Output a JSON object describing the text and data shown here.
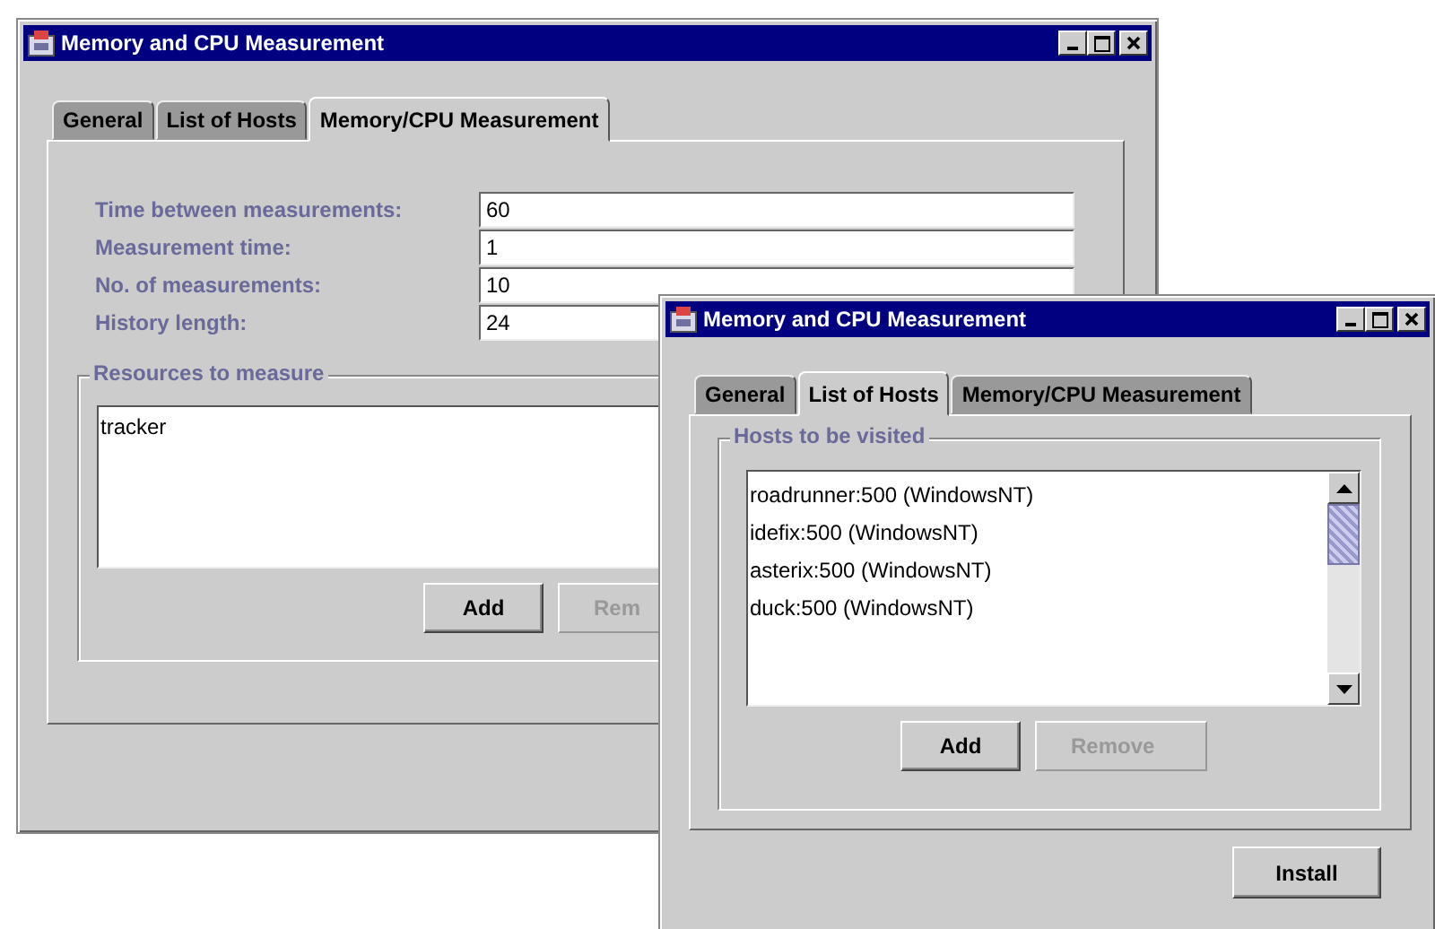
{
  "windows": [
    {
      "title": "Memory and CPU Measurement",
      "tabs": [
        {
          "label": "General",
          "selected": false
        },
        {
          "label": "List of Hosts",
          "selected": false
        },
        {
          "label": "Memory/CPU Measurement",
          "selected": true
        }
      ],
      "fields": [
        {
          "label": "Time between measurements:",
          "value": "60"
        },
        {
          "label": "Measurement time:",
          "value": "1"
        },
        {
          "label": "No. of measurements:",
          "value": "10"
        },
        {
          "label": "History length:",
          "value": "24"
        }
      ],
      "group": {
        "title": "Resources to measure",
        "items": [
          "tracker"
        ],
        "buttons": [
          {
            "label": "Add",
            "disabled": false
          },
          {
            "label": "Rem",
            "disabled": true
          }
        ]
      }
    },
    {
      "title": "Memory and CPU Measurement",
      "tabs": [
        {
          "label": "General",
          "selected": false
        },
        {
          "label": "List of Hosts",
          "selected": true
        },
        {
          "label": "Memory/CPU Measurement",
          "selected": false
        }
      ],
      "group": {
        "title": "Hosts to be visited",
        "items": [
          "roadrunner:500 (WindowsNT)",
          "idefix:500 (WindowsNT)",
          "asterix:500 (WindowsNT)",
          "duck:500 (WindowsNT)"
        ],
        "buttons": [
          {
            "label": "Add",
            "disabled": false
          },
          {
            "label": "Remove",
            "disabled": true
          }
        ]
      },
      "footer_buttons": [
        {
          "label": "Install",
          "disabled": false
        }
      ]
    }
  ]
}
